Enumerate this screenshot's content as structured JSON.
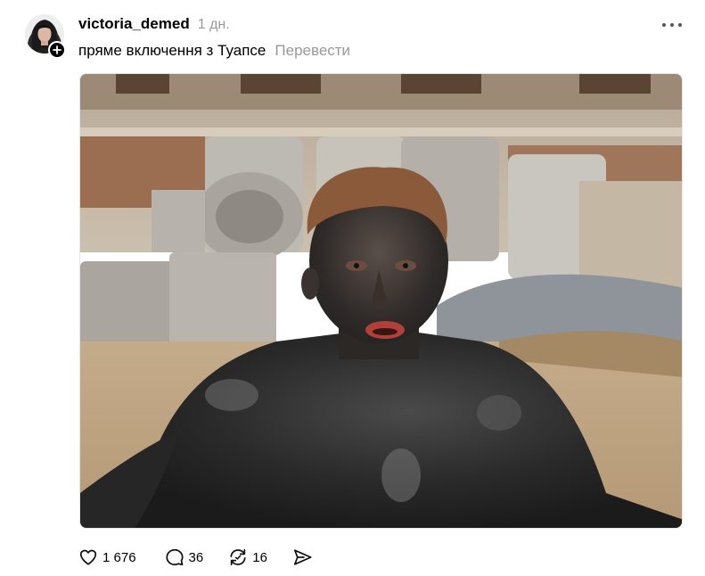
{
  "post": {
    "username": "victoria_demed",
    "timestamp": "1 дн.",
    "caption": "пряме включення з Туапсе",
    "translate_label": "Перевести",
    "image_icon": "photo",
    "actions": {
      "likes": "1 676",
      "comments": "36",
      "reposts": "16",
      "share_icon": "send-icon"
    }
  },
  "colors": {
    "text": "#000000",
    "muted": "#999999",
    "background": "#ffffff"
  }
}
